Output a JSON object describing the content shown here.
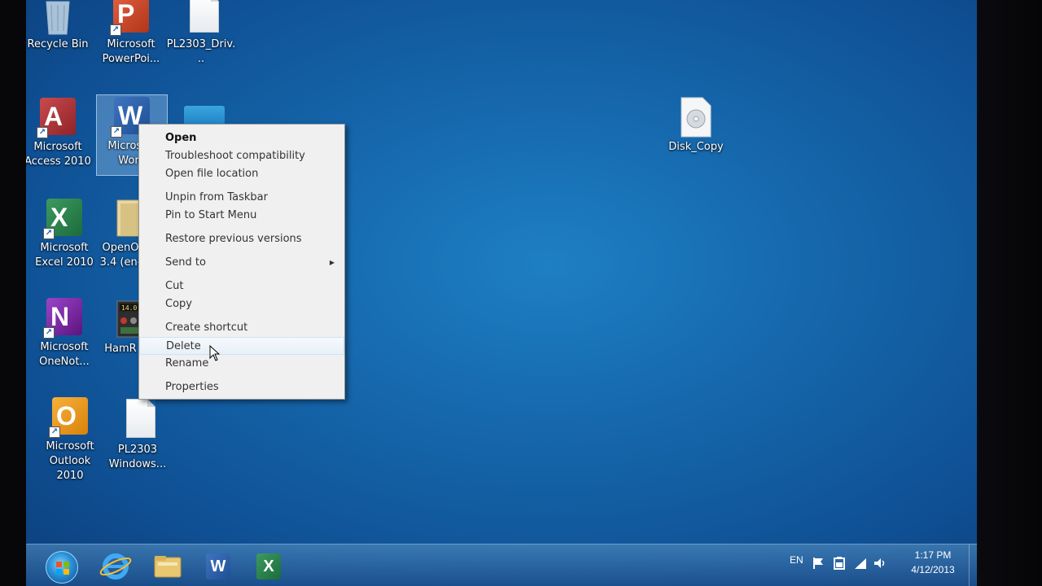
{
  "desktop": {
    "icons": [
      {
        "label": "Recycle Bin",
        "icon": "recycle-bin-icon"
      },
      {
        "label": "Microsoft PowerPoi...",
        "icon": "powerpoint-icon"
      },
      {
        "label": "PL2303_Driv...",
        "icon": "file-icon"
      },
      {
        "label": "Microsoft Access 2010",
        "icon": "access-icon"
      },
      {
        "label": "Microsoft Word",
        "icon": "word-icon"
      },
      {
        "label": "Microsoft Excel 2010",
        "icon": "excel-icon"
      },
      {
        "label": "OpenO 3.4 (en-",
        "icon": "folder-icon"
      },
      {
        "label": "Microsoft OneNot...",
        "icon": "onenote-icon"
      },
      {
        "label": "HamR",
        "icon": "hamradio-icon"
      },
      {
        "label": "Microsoft Outlook 2010",
        "icon": "outlook-icon"
      },
      {
        "label": "PL2303 Windows...",
        "icon": "file-icon"
      },
      {
        "label": "Disk_Copy",
        "icon": "disk-image-icon"
      }
    ]
  },
  "context_menu": {
    "items": [
      {
        "label": "Open",
        "bold": true
      },
      {
        "label": "Troubleshoot compatibility"
      },
      {
        "label": "Open file location"
      },
      {
        "label": "Unpin from Taskbar"
      },
      {
        "label": "Pin to Start Menu"
      },
      {
        "label": "Restore previous versions"
      },
      {
        "label": "Send to",
        "submenu": true
      },
      {
        "label": "Cut"
      },
      {
        "label": "Copy"
      },
      {
        "label": "Create shortcut"
      },
      {
        "label": "Delete",
        "hover": true
      },
      {
        "label": "Rename"
      },
      {
        "label": "Properties"
      }
    ]
  },
  "taskbar": {
    "pinned": [
      "internet-explorer-icon",
      "file-explorer-icon",
      "word-icon",
      "excel-icon"
    ],
    "tray": {
      "language": "EN",
      "time": "1:17 PM",
      "date": "4/12/2013"
    }
  },
  "colors": {
    "desktop": "#1668ad",
    "menu_bg": "#f0f0f0",
    "word": "#2b5797",
    "excel": "#217346",
    "access": "#a4373a",
    "powerpoint": "#d24726",
    "onenote": "#7719aa",
    "outlook": "#f09b17"
  }
}
